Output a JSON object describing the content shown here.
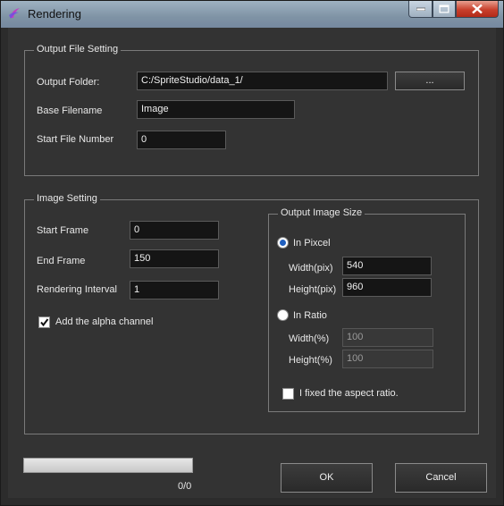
{
  "window": {
    "title": "Rendering"
  },
  "output_file_setting": {
    "legend": "Output File Setting",
    "output_folder_label": "Output Folder:",
    "output_folder_value": "C:/SpriteStudio/data_1/",
    "browse_label": "...",
    "base_filename_label": "Base Filename",
    "base_filename_value": "Image",
    "start_file_number_label": "Start File Number",
    "start_file_number_value": "0"
  },
  "image_setting": {
    "legend": "Image Setting",
    "start_frame_label": "Start Frame",
    "start_frame_value": "0",
    "end_frame_label": "End Frame",
    "end_frame_value": "150",
    "rendering_interval_label": "Rendering Interval",
    "rendering_interval_value": "1",
    "alpha_label": "Add the alpha channel",
    "alpha_checked": true
  },
  "output_image_size": {
    "legend": "Output Image Size",
    "in_pixel_label": "In Pixcel",
    "in_pixel_selected": true,
    "width_pix_label": "Width(pix)",
    "width_pix_value": "540",
    "height_pix_label": "Height(pix)",
    "height_pix_value": "960",
    "in_ratio_label": "In Ratio",
    "in_ratio_selected": false,
    "width_pct_label": "Width(%)",
    "width_pct_value": "100",
    "height_pct_label": "Height(%)",
    "height_pct_value": "100",
    "aspect_label": "I fixed the aspect ratio.",
    "aspect_checked": false
  },
  "footer": {
    "progress_text": "0/0",
    "progress_fraction": 0,
    "ok_label": "OK",
    "cancel_label": "Cancel"
  },
  "colors": {
    "accent": "#1f5fbf",
    "background": "#333333",
    "field": "#151515"
  }
}
